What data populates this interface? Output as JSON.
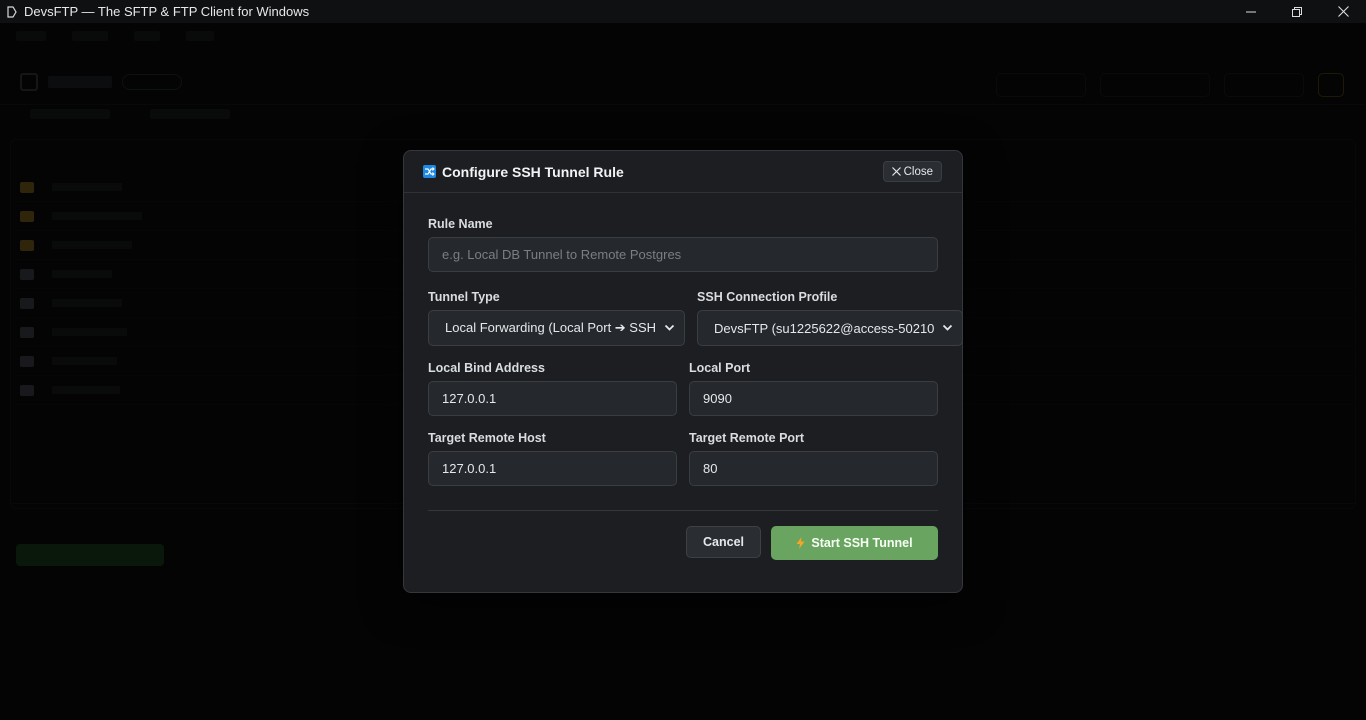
{
  "window": {
    "title": "DevsFTP — The SFTP & FTP Client for Windows"
  },
  "modal": {
    "title": "Configure SSH Tunnel Rule",
    "close_label": "Close",
    "rule_name": {
      "label": "Rule Name",
      "placeholder": "e.g. Local DB Tunnel to Remote Postgres",
      "value": ""
    },
    "tunnel_type": {
      "label": "Tunnel Type",
      "selected": "Local Forwarding (Local Port ➔ SSH"
    },
    "ssh_profile": {
      "label": "SSH Connection Profile",
      "selected": "DevsFTP (su1225622@access-50210"
    },
    "local_bind_address": {
      "label": "Local Bind Address",
      "value": "127.0.0.1"
    },
    "local_port": {
      "label": "Local Port",
      "value": "9090"
    },
    "target_remote_host": {
      "label": "Target Remote Host",
      "value": "127.0.0.1"
    },
    "target_remote_port": {
      "label": "Target Remote Port",
      "value": "80"
    },
    "cancel_label": "Cancel",
    "start_label": "Start SSH Tunnel"
  },
  "colors": {
    "accent_green": "#6aa461",
    "icon_blue": "#1e88e5",
    "bolt": "#f5a623"
  },
  "icons": {
    "tunnel": "tunnel-icon",
    "close": "close-icon",
    "bolt": "bolt-icon",
    "chevron": "chevron-down-icon"
  }
}
